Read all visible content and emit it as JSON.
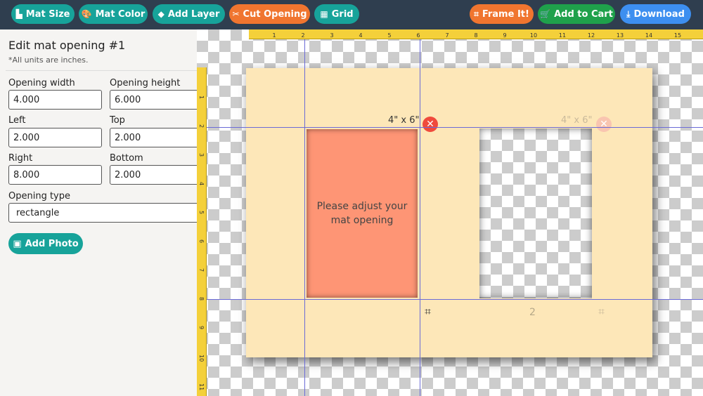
{
  "toolbar": {
    "mat_size": {
      "label": "Mat Size",
      "icon": "▙"
    },
    "mat_color": {
      "label": "Mat Color",
      "icon": "🎨"
    },
    "add_layer": {
      "label": "Add Layer",
      "icon": "◆"
    },
    "cut_opening": {
      "label": "Cut Opening",
      "icon": "✂"
    },
    "grid": {
      "label": "Grid",
      "icon": "▦"
    },
    "frame_it": {
      "label": "Frame It!",
      "icon": "⌗"
    },
    "add_to_cart": {
      "label": "Add to Cart",
      "icon": "🛒"
    },
    "download": {
      "label": "Download",
      "icon": "⤓"
    }
  },
  "sidebar": {
    "title": "Edit mat opening #1",
    "note": "*All units are inches.",
    "opening_width": {
      "label": "Opening width",
      "value": "4.000"
    },
    "opening_height": {
      "label": "Opening height",
      "value": "6.000"
    },
    "left": {
      "label": "Left",
      "value": "2.000"
    },
    "top": {
      "label": "Top",
      "value": "2.000"
    },
    "right": {
      "label": "Right",
      "value": "8.000"
    },
    "bottom": {
      "label": "Bottom",
      "value": "2.000"
    },
    "opening_type": {
      "label": "Opening type",
      "value": "rectangle"
    },
    "add_photo": {
      "label": "Add Photo",
      "icon": "▣"
    }
  },
  "ruler": {
    "top": [
      "1",
      "2",
      "3",
      "4",
      "5",
      "6",
      "7",
      "8",
      "9",
      "10",
      "11",
      "12",
      "13",
      "14",
      "15"
    ],
    "left": [
      "1",
      "2",
      "3",
      "4",
      "5",
      "6",
      "7",
      "8",
      "9",
      "10",
      "11"
    ]
  },
  "canvas": {
    "opening1_text": "Please adjust your mat opening",
    "opening1_dim": "4\" x 6\"",
    "opening2_dim": "4\" x 6\"",
    "opening2_number": "2",
    "close_icon": "✕",
    "crop_icon": "⌗"
  },
  "colors": {
    "toolbar_bg": "#2f3e4f",
    "teal": "#17a39a",
    "orange": "#f0752f",
    "green": "#1fa14b",
    "blue": "#3d8ff0",
    "mat": "#fde7b8",
    "opening_active": "#fe9575",
    "ruler": "#f4d03a"
  }
}
